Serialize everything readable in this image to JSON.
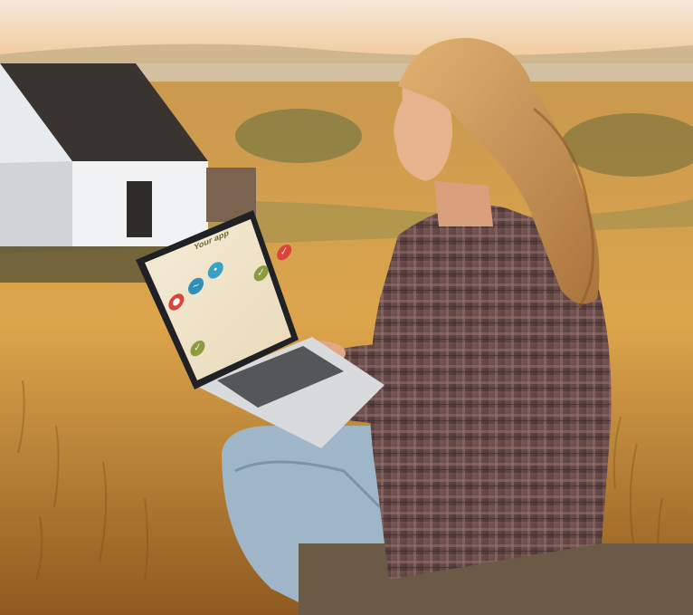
{
  "scene": {
    "description_free": true
  },
  "laptop_screen": {
    "title": "Your app",
    "icons": [
      {
        "name": "location-pin-icon",
        "color": "#d9453b"
      },
      {
        "name": "wave-icon",
        "color": "#2f8fb7"
      },
      {
        "name": "drop-icon",
        "color": "#3aa0c4"
      }
    ],
    "right_buttons": [
      {
        "name": "check-button",
        "color": "#8a9c3e"
      },
      {
        "name": "confirm-button",
        "color": "#d9453b"
      }
    ],
    "bottom_left_button": {
      "name": "check-button-bottom",
      "color": "#8a9c3e"
    }
  },
  "colors": {
    "sky_top": "#f6e3cf",
    "sky_bottom": "#f0c79a",
    "field": "#d7a24d",
    "field_dark": "#a86a24",
    "barn_wall": "#e9ecef",
    "barn_roof": "#3b3633",
    "shirt": "#6b4e4b",
    "jeans": "#9fb4c7",
    "hair": "#c69356",
    "skin": "#e4b08b"
  }
}
